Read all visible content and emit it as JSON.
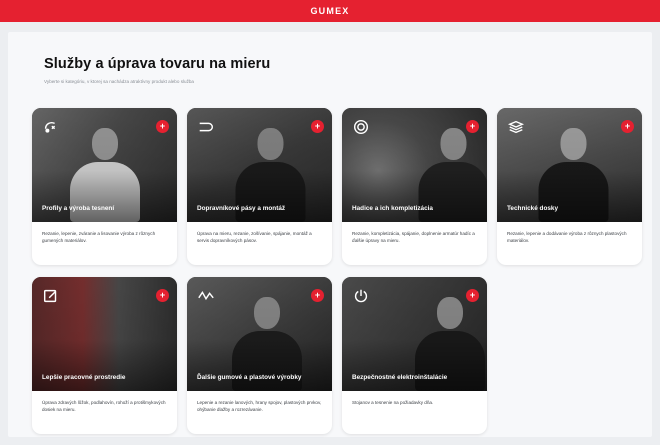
{
  "brand": {
    "logo": "GUMEX"
  },
  "header": {
    "title": "Služby a úprava tovaru na mieru",
    "subtitle": "Vyberte si kategóriu, v ktorej sa nachádza atraktívny produkt alebo služba"
  },
  "cards": [
    {
      "title": "Profily a výroba tesnení",
      "description": "Rezanie, lepenie, zváranie a lisovanie výroba z rôznych gumených materiálov.",
      "icon": "rubber-profile-icon",
      "add_label": "+"
    },
    {
      "title": "Dopravníkové pásy a montáž",
      "description": "Úprava na mieru, rezanie, zošívanie, spájanie, montáž a servis dopravníkových pásov.",
      "icon": "conveyor-icon",
      "add_label": "+"
    },
    {
      "title": "Hadice a ich kompletizácia",
      "description": "Rezanie, kompletizácia, spájanie, doplnenie armatúr hadíc a ďalšie úpravy na mieru.",
      "icon": "hose-icon",
      "add_label": "+"
    },
    {
      "title": "Technické dosky",
      "description": "Rezanie, lepenie a dodávanie výroba z rôznych plastových materiálov.",
      "icon": "layers-icon",
      "add_label": "+"
    },
    {
      "title": "Lepšie pracovné prostredie",
      "description": "Úprava zdravých lôžok, podlahovín, rohoží a protišmykových dosiek na mieru.",
      "icon": "edit-icon",
      "add_label": "+"
    },
    {
      "title": "Ďalšie gumové a plastové výrobky",
      "description": "Lepenie a rezanie lanových, hrany spojov, plastových prvkov, ohýbanie dlažby a rozrezávanie.",
      "icon": "wave-icon",
      "add_label": "+"
    },
    {
      "title": "Bezpečnostné elektroinštalácie",
      "description": "Stojanov a tesnenie na požiadavky dňa.",
      "icon": "power-icon",
      "add_label": "+"
    }
  ],
  "colors": {
    "brand_red": "#e52130",
    "page_bg": "#eceef1",
    "card_bg": "#ffffff"
  }
}
